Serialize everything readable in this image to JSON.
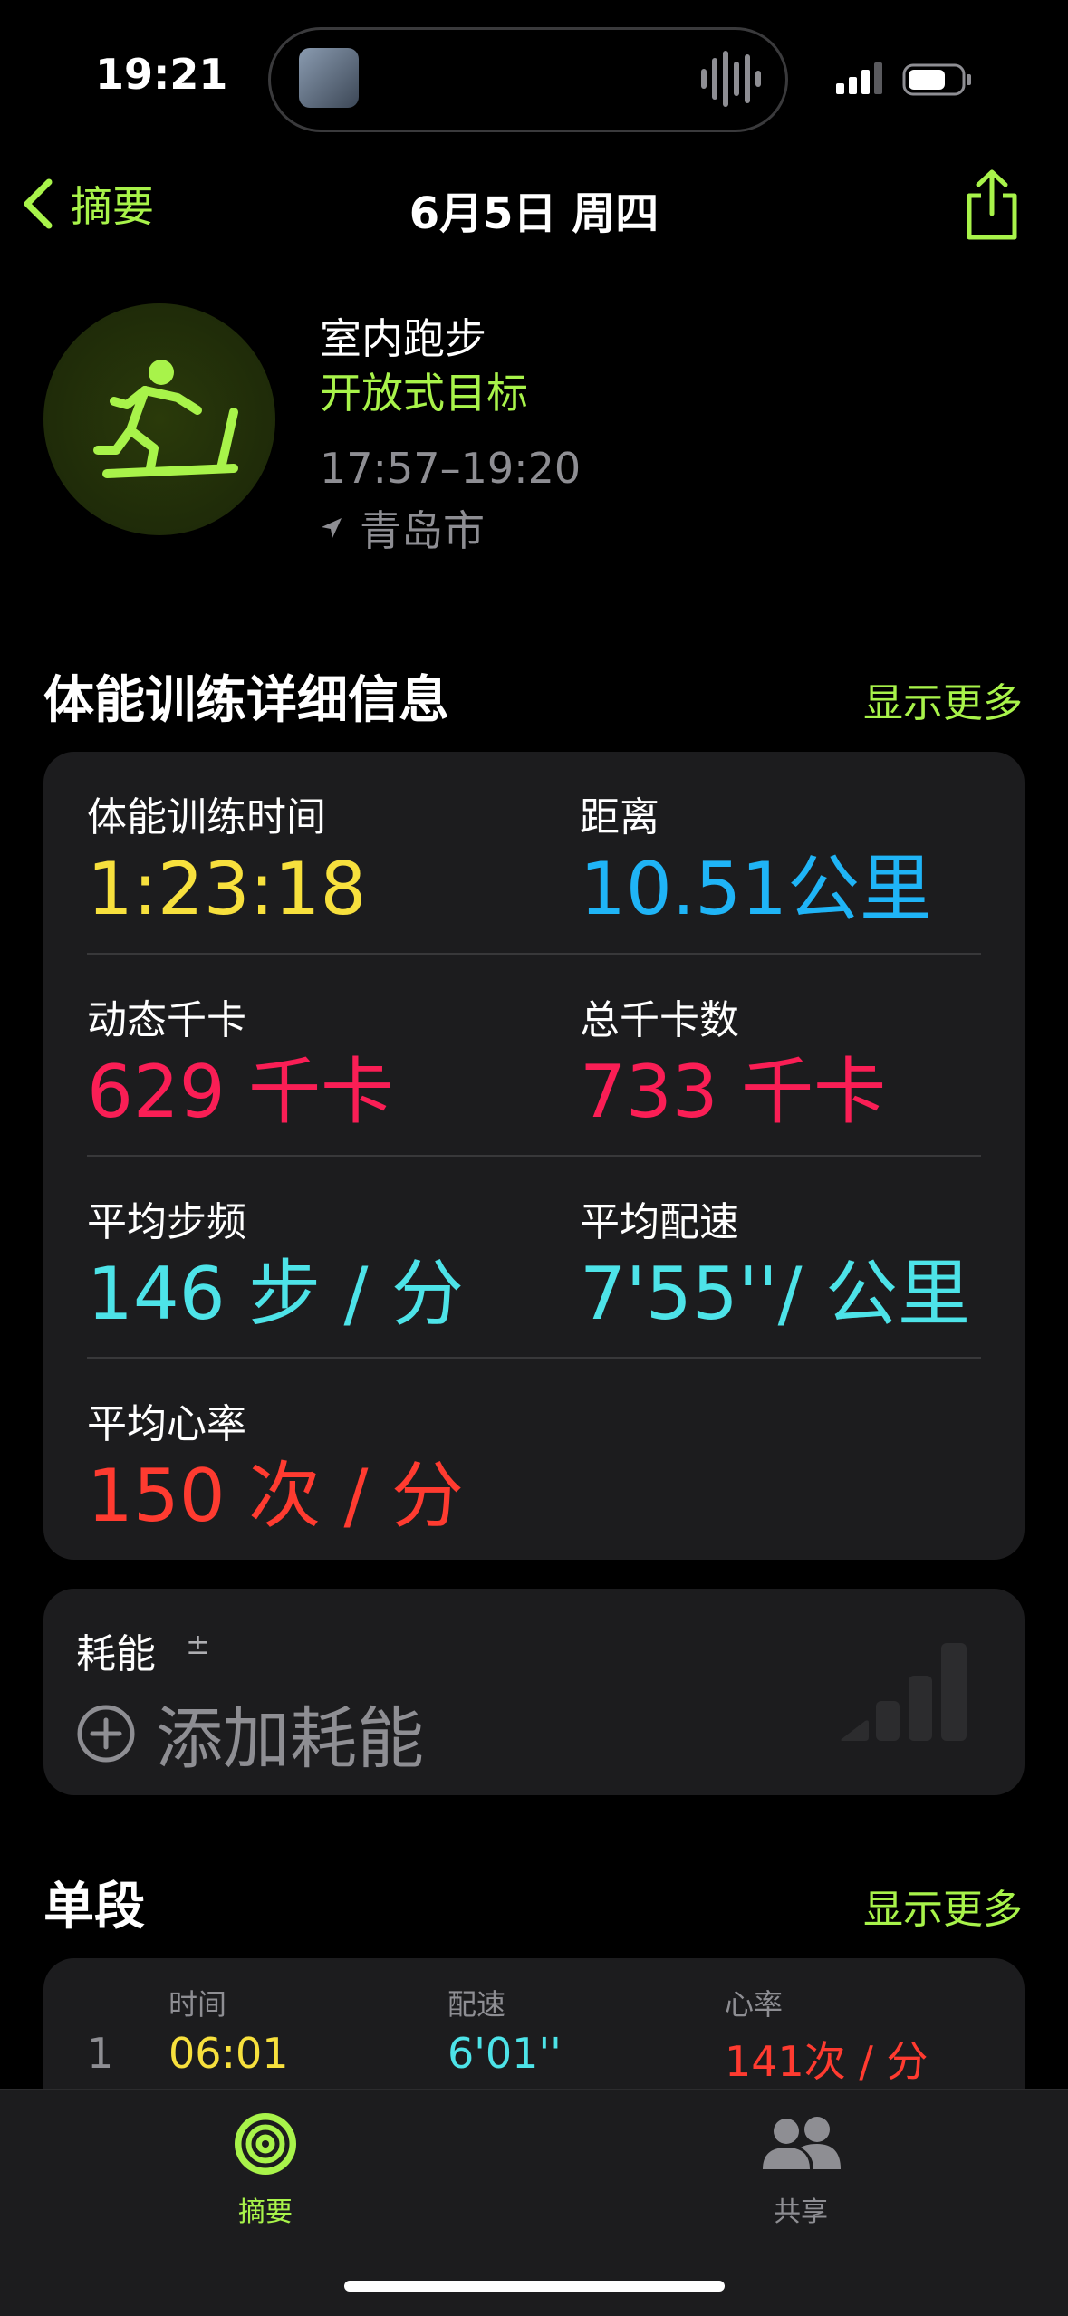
{
  "status_bar": {
    "time": "19:21"
  },
  "nav": {
    "back_label": "摘要",
    "title": "6月5日 周四"
  },
  "workout": {
    "name": "室内跑步",
    "goal": "开放式目标",
    "time_range": "17:57–19:20",
    "location": "青岛市"
  },
  "details": {
    "title": "体能训练详细信息",
    "more": "显示更多",
    "metrics": [
      {
        "label": "体能训练时间",
        "value": "1:23:18",
        "color": "#f7e03d"
      },
      {
        "label": "距离",
        "value": "10.51公里",
        "color": "#1fb4f6"
      },
      {
        "label": "动态千卡",
        "value": "629 千卡",
        "color": "#fa1e55"
      },
      {
        "label": "总千卡数",
        "value": "733 千卡",
        "color": "#fa1e55"
      },
      {
        "label": "平均步频",
        "value": "146 步 / 分",
        "color": "#4de3e8"
      },
      {
        "label": "平均配速",
        "value": "7'55''/ 公里",
        "color": "#4de3e8"
      },
      {
        "label": "平均心率",
        "value": "150 次 / 分",
        "color": "#ff3b30"
      }
    ]
  },
  "energy": {
    "label": "耗能",
    "pm": "±",
    "add_label": "添加耗能"
  },
  "splits": {
    "title": "单段",
    "more": "显示更多",
    "headers": [
      "时间",
      "配速",
      "心率"
    ],
    "rows": [
      {
        "index": "1",
        "time": "06:01",
        "pace": "6'01''",
        "hr": "141次 / 分"
      }
    ]
  },
  "tabs": [
    {
      "label": "摘要",
      "icon": "activity-rings-icon",
      "active": true
    },
    {
      "label": "共享",
      "icon": "people-icon",
      "active": false
    }
  ],
  "colors": {
    "accent": "#a8f34a",
    "time": "#f7e03d",
    "distance": "#1fb4f6",
    "calories": "#fa1e55",
    "cadence": "#4de3e8",
    "heart": "#ff3b30"
  }
}
